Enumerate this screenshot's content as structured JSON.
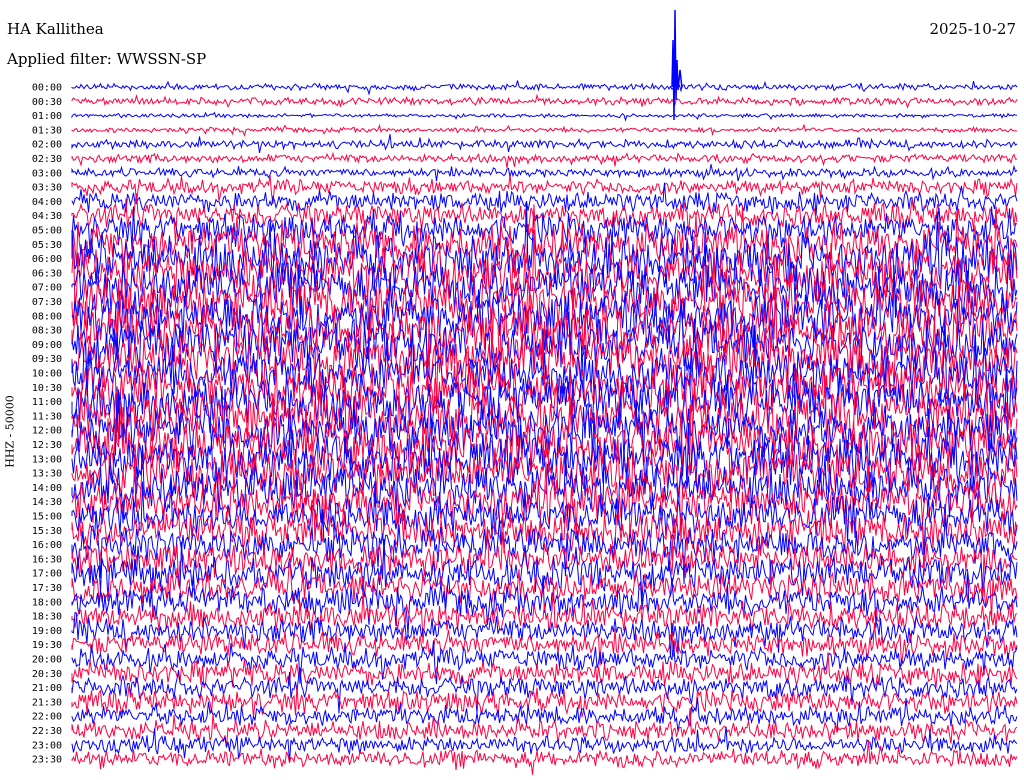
{
  "header": {
    "station": "HA Kallithea",
    "date": "2025-10-27",
    "filter_text": "Applied filter: WWSSN-SP"
  },
  "channel_label": "HHZ - 50000",
  "chart_data": {
    "type": "line",
    "title": "HA Kallithea",
    "subtitle": "Applied filter: WWSSN-SP",
    "ylabel": "HHZ - 50000",
    "xlabel": "",
    "colors": [
      "#0000ff",
      "#ff0040"
    ],
    "row_labels": [
      "00:00",
      "00:30",
      "01:00",
      "01:30",
      "02:00",
      "02:30",
      "03:00",
      "03:30",
      "04:00",
      "04:30",
      "05:00",
      "05:30",
      "06:00",
      "06:30",
      "07:00",
      "07:30",
      "08:00",
      "08:30",
      "09:00",
      "09:30",
      "10:00",
      "10:30",
      "11:00",
      "11:30",
      "12:00",
      "12:30",
      "13:00",
      "13:30",
      "14:00",
      "14:30",
      "15:00",
      "15:30",
      "16:00",
      "16:30",
      "17:00",
      "17:30",
      "18:00",
      "18:30",
      "19:00",
      "19:30",
      "20:00",
      "20:30",
      "21:00",
      "21:30",
      "22:00",
      "22:30",
      "23:00",
      "23:30"
    ],
    "relative_amplitude": [
      0.25,
      0.3,
      0.15,
      0.2,
      0.35,
      0.35,
      0.35,
      0.6,
      0.8,
      1.0,
      1.3,
      1.7,
      2.0,
      2.0,
      2.0,
      2.0,
      2.0,
      2.0,
      2.0,
      2.0,
      2.0,
      2.0,
      2.0,
      2.0,
      2.0,
      2.0,
      2.0,
      2.0,
      1.8,
      1.7,
      1.6,
      1.5,
      1.4,
      1.3,
      1.3,
      1.2,
      1.2,
      1.1,
      1.0,
      0.9,
      0.9,
      0.9,
      0.9,
      0.9,
      0.8,
      0.8,
      0.7,
      0.7
    ],
    "grid": false,
    "legend": "none"
  }
}
